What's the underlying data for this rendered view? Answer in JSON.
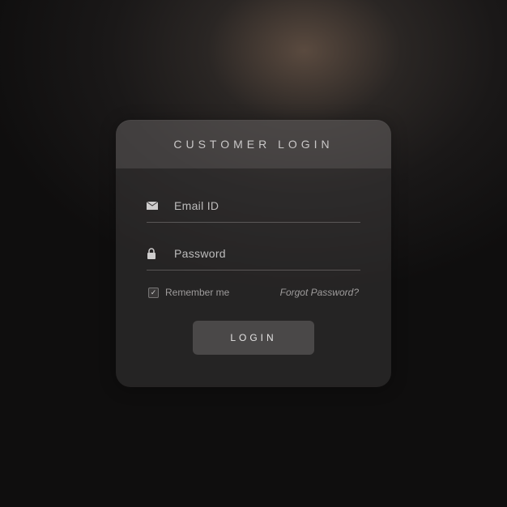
{
  "header": {
    "title": "CUSTOMER LOGIN"
  },
  "fields": {
    "email": {
      "placeholder": "Email ID",
      "value": ""
    },
    "password": {
      "placeholder": "Password",
      "value": ""
    }
  },
  "remember": {
    "label": "Remember me",
    "checked": true
  },
  "forgot": {
    "label": "Forgot Password?"
  },
  "submit": {
    "label": "LOGIN"
  },
  "icons": {
    "mail": "mail-icon",
    "lock": "lock-icon",
    "check": "check-icon"
  }
}
